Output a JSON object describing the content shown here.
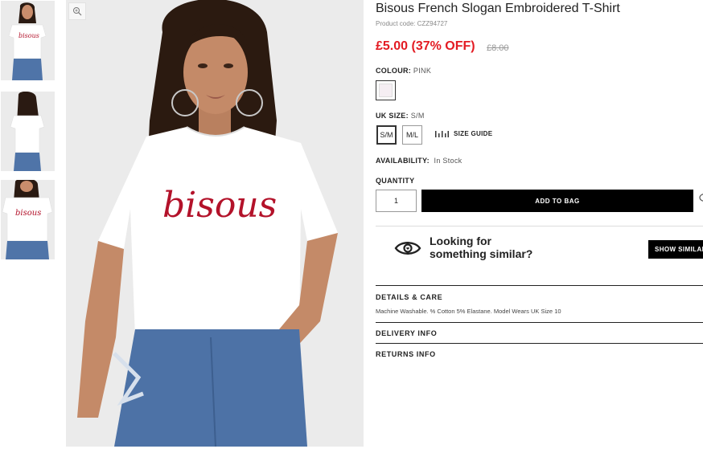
{
  "product": {
    "title": "Bisous French Slogan Embroidered T-Shirt",
    "code": "Product code: CZZ94727",
    "price_now": "£5.00 (37% OFF)",
    "price_was": "£8.00"
  },
  "colour": {
    "label": "COLOUR:",
    "value": "PINK"
  },
  "size": {
    "label": "UK SIZE:",
    "value": "S/M",
    "options": [
      "S/M",
      "M/L"
    ],
    "guide_label": "SIZE GUIDE"
  },
  "availability": {
    "label": "AVAILABILITY:",
    "value": "In Stock"
  },
  "quantity": {
    "label": "QUANTITY",
    "value": "1"
  },
  "add_to_bag": "ADD TO BAG",
  "similar": {
    "line1": "Looking for",
    "line2": "something similar?",
    "button": "SHOW SIMILAR"
  },
  "accordion": {
    "details_title": "DETAILS & CARE",
    "details_body": "Machine Washable. % Cotton 5% Elastane. Model Wears UK Size 10",
    "delivery_title": "DELIVERY INFO",
    "returns_title": "RETURNS INFO"
  },
  "image_text": "bisous",
  "colors": {
    "price_red": "#e31b23",
    "button_black": "#000000",
    "embroidery_red": "#b3122a"
  },
  "icons": [
    "zoom-icon",
    "ruler-icon",
    "eye-icon",
    "heart-icon"
  ]
}
